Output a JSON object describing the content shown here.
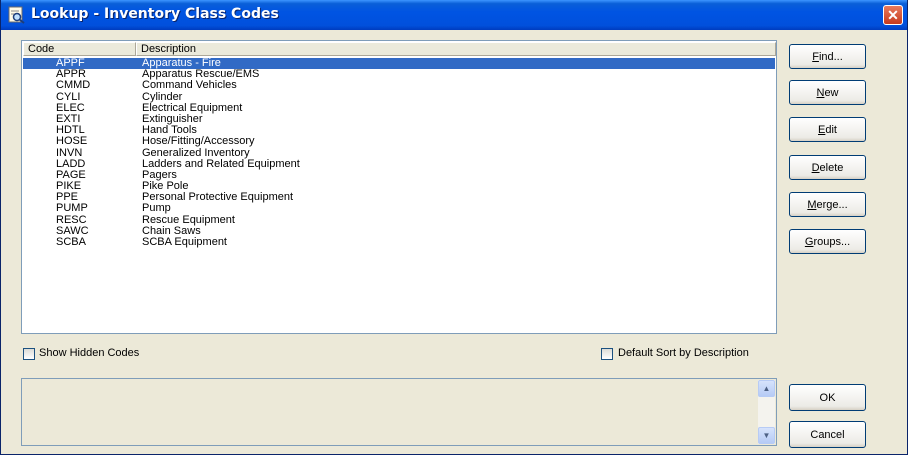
{
  "window": {
    "title": "Lookup - Inventory Class Codes",
    "close_glyph": "✕"
  },
  "list": {
    "columns": {
      "code": "Code",
      "description": "Description"
    },
    "rows": [
      {
        "code": "APPF",
        "description": "Apparatus - Fire",
        "selected": true
      },
      {
        "code": "APPR",
        "description": "Apparatus Rescue/EMS"
      },
      {
        "code": "CMMD",
        "description": "Command Vehicles"
      },
      {
        "code": "CYLI",
        "description": "Cylinder"
      },
      {
        "code": "ELEC",
        "description": "Electrical Equipment"
      },
      {
        "code": "EXTI",
        "description": "Extinguisher"
      },
      {
        "code": "HDTL",
        "description": "Hand Tools"
      },
      {
        "code": "HOSE",
        "description": "Hose/Fitting/Accessory"
      },
      {
        "code": "INVN",
        "description": "Generalized Inventory"
      },
      {
        "code": "LADD",
        "description": "Ladders and Related Equipment"
      },
      {
        "code": "PAGE",
        "description": "Pagers"
      },
      {
        "code": "PIKE",
        "description": "Pike Pole"
      },
      {
        "code": "PPE",
        "description": "Personal Protective Equipment"
      },
      {
        "code": "PUMP",
        "description": "Pump"
      },
      {
        "code": "RESC",
        "description": "Rescue Equipment"
      },
      {
        "code": "SAWC",
        "description": "Chain Saws"
      },
      {
        "code": "SCBA",
        "description": "SCBA Equipment"
      }
    ]
  },
  "options": {
    "show_hidden": {
      "label": "Show Hidden Codes",
      "checked": false
    },
    "default_sort": {
      "label": "Default Sort by Description",
      "checked": false
    }
  },
  "buttons": {
    "find": {
      "hotkey": "F",
      "rest": "ind..."
    },
    "new": {
      "hotkey": "N",
      "rest": "ew"
    },
    "edit": {
      "hotkey": "E",
      "rest": "dit"
    },
    "delete": {
      "hotkey": "D",
      "rest": "elete"
    },
    "merge": {
      "hotkey": "M",
      "rest": "erge..."
    },
    "groups": {
      "hotkey": "G",
      "rest": "roups..."
    },
    "ok": "OK",
    "cancel": "Cancel"
  },
  "memo": {
    "text": ""
  },
  "icons": {
    "title": "lookup-binoculars-icon",
    "scroll_up": "▲",
    "scroll_down": "▼"
  },
  "colors": {
    "title_bar": "#0054e3",
    "selection": "#316ac5",
    "dialog_bg": "#ece9d8"
  }
}
